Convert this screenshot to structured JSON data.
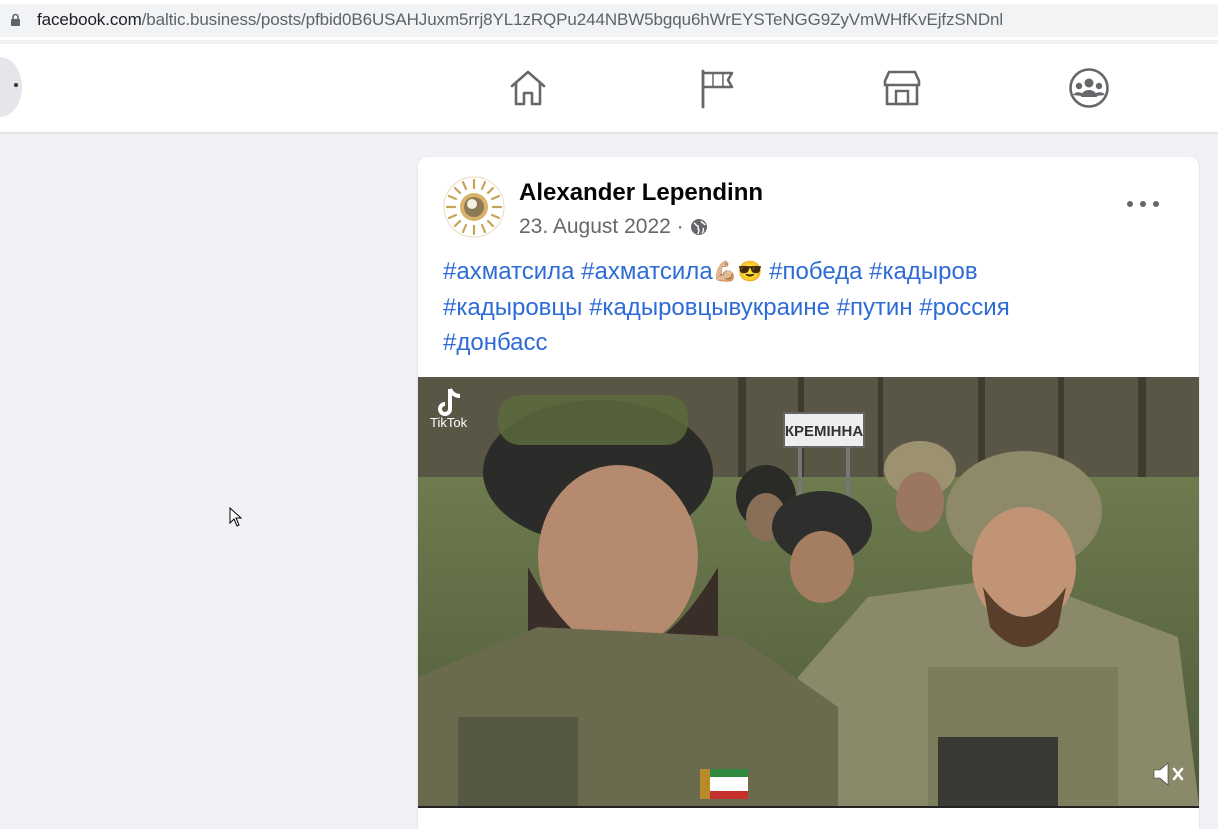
{
  "browser": {
    "url_domain": "facebook.com",
    "url_path": "/baltic.business/posts/pfbid0B6USAHJuxm5rrj8YL1zRQPu244NBW5bgqu6hWrEYSTeNGG9ZyVmWHfKvEjfzSNDnl"
  },
  "topnav": {
    "icons": [
      "home-icon",
      "pages-flag-icon",
      "marketplace-icon",
      "groups-icon"
    ]
  },
  "post": {
    "author": "Alexander Lependinn",
    "date": "23. August 2022 ·",
    "hashtags_line1_a": "#ахматсила #ахматсила",
    "emoji_1": "💪🏼",
    "emoji_2": "😎",
    "hashtags_line1_b": " #победа #кадыров",
    "hashtags_line2": "#кадыровцы #кадыровцывукраине #путин #россия",
    "hashtags_line3": "#донбасс",
    "video": {
      "watermark": "TikTok",
      "sign_text": "КРЕМІННА"
    }
  },
  "colors": {
    "link": "#2d6bd6",
    "background": "#f0f2f5",
    "icon_gray": "#65676b"
  }
}
